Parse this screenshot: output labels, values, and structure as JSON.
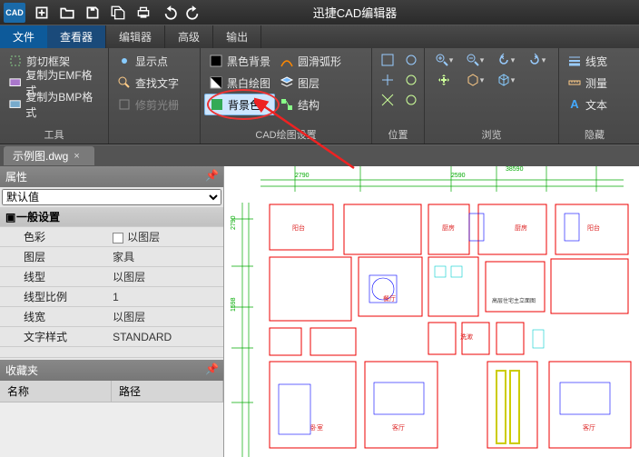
{
  "app_title": "迅捷CAD编辑器",
  "logo_text": "CAD",
  "menus": {
    "file": "文件",
    "viewer": "查看器",
    "editor": "编辑器",
    "adv": "高级",
    "out": "输出"
  },
  "tabs": {
    "doc": "示例图.dwg"
  },
  "ribbon": {
    "g1": {
      "crop": "剪切框架",
      "emf": "复制为EMF格式",
      "bmp": "复制为BMP格式",
      "label": "工具"
    },
    "g2": {
      "showpt": "显示点",
      "findtxt": "查找文字",
      "trim": "修剪光栅"
    },
    "g3": {
      "blackbg": "黑色背景",
      "bwdraw": "黑白绘图",
      "bgcolor": "背景色",
      "arc": "圆滑弧形",
      "layer": "图层",
      "struct": "结构",
      "label": "CAD绘图设置"
    },
    "g4": {
      "label": "位置"
    },
    "g5": {
      "label": "浏览"
    },
    "g6": {
      "lw": "线宽",
      "meas": "测量",
      "text": "文本",
      "label": "隐藏"
    }
  },
  "props": {
    "title": "属性",
    "combo_default": "默认值",
    "section": "一般设置",
    "rows": {
      "color": {
        "k": "色彩",
        "v": "以图层"
      },
      "layer": {
        "k": "图层",
        "v": "家具"
      },
      "ltype": {
        "k": "线型",
        "v": "以图层"
      },
      "lscale": {
        "k": "线型比例",
        "v": "1"
      },
      "lwidth": {
        "k": "线宽",
        "v": "以图层"
      },
      "tstyle": {
        "k": "文字样式",
        "v": "STANDARD"
      }
    }
  },
  "fav": {
    "title": "收藏夹",
    "name": "名称",
    "path": "路径"
  }
}
